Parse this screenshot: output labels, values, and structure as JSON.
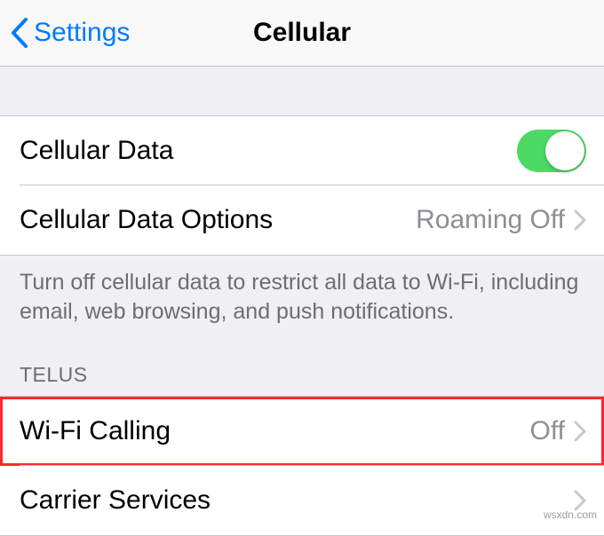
{
  "nav": {
    "back_label": "Settings",
    "title": "Cellular"
  },
  "group1": {
    "cellular_data_label": "Cellular Data",
    "cellular_data_on": true,
    "cellular_data_options_label": "Cellular Data Options",
    "cellular_data_options_value": "Roaming Off"
  },
  "footer1": "Turn off cellular data to restrict all data to Wi-Fi, including email, web browsing, and push notifications.",
  "section_header": "TELUS",
  "group2": {
    "wifi_calling_label": "Wi-Fi Calling",
    "wifi_calling_value": "Off",
    "carrier_services_label": "Carrier Services"
  },
  "watermark": "wsxdn.com"
}
